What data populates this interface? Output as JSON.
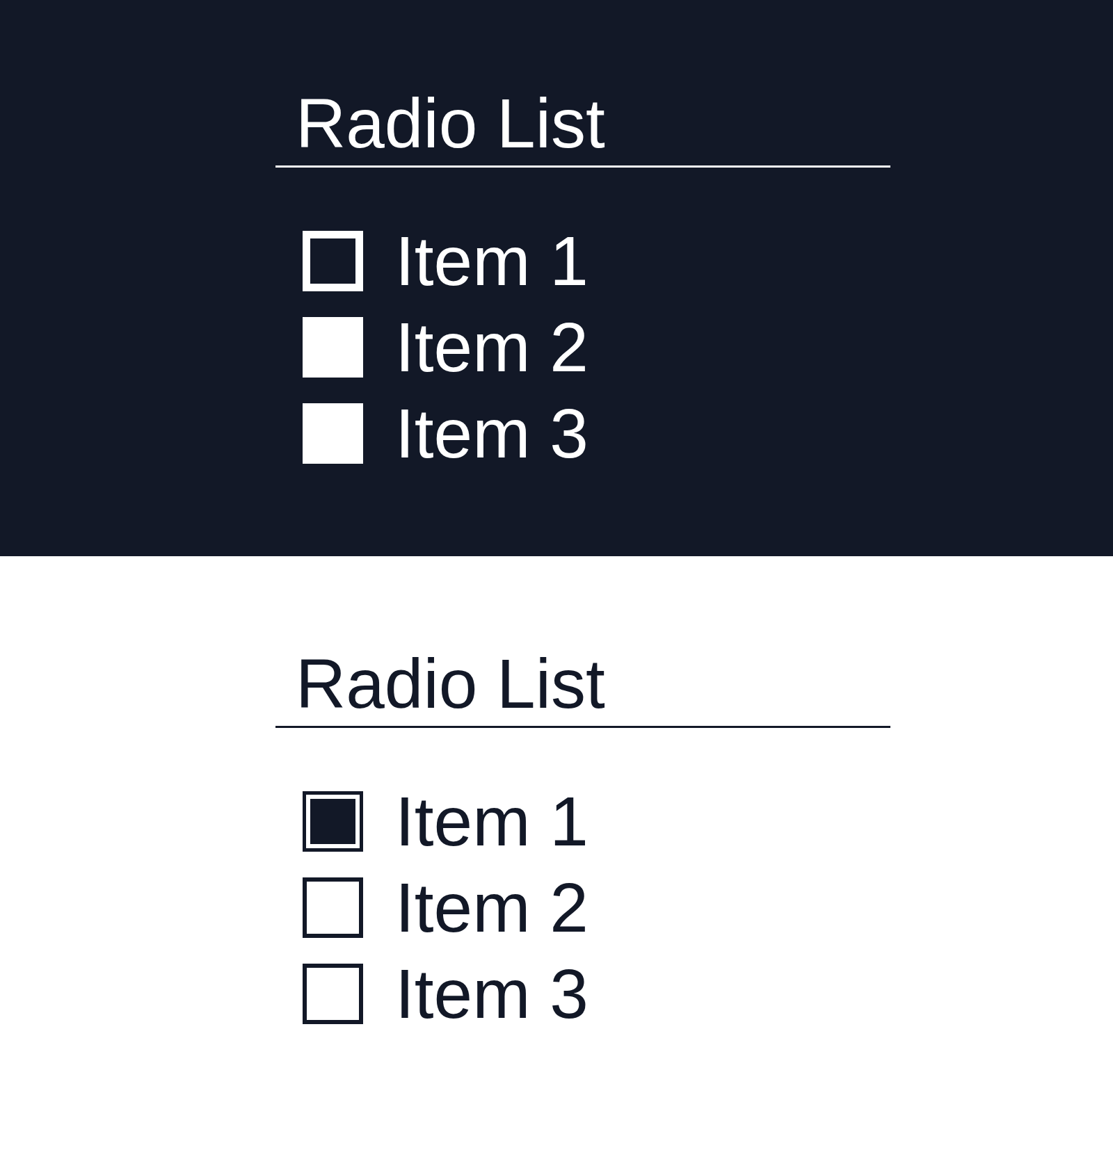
{
  "panels": [
    {
      "kind": "dark",
      "title": "Radio List",
      "items": [
        {
          "label": "Item 1",
          "selected": true
        },
        {
          "label": "Item 2",
          "selected": false
        },
        {
          "label": "Item 3",
          "selected": false
        }
      ]
    },
    {
      "kind": "light",
      "title": "Radio List",
      "items": [
        {
          "label": "Item 1",
          "selected": true
        },
        {
          "label": "Item 2",
          "selected": false
        },
        {
          "label": "Item 3",
          "selected": false
        }
      ]
    }
  ]
}
